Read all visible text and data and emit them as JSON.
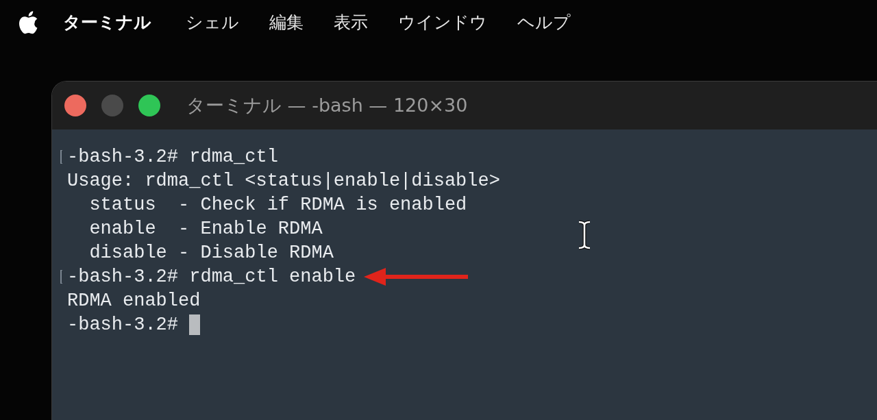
{
  "menu_bar": {
    "items": [
      {
        "label": "ターミナル",
        "kind": "app"
      },
      {
        "label": "シェル",
        "kind": "menu"
      },
      {
        "label": "編集",
        "kind": "menu"
      },
      {
        "label": "表示",
        "kind": "menu"
      },
      {
        "label": "ウインドウ",
        "kind": "menu"
      },
      {
        "label": "ヘルプ",
        "kind": "menu"
      }
    ]
  },
  "window": {
    "title": "ターミナル — -bash — 120×30",
    "lines": [
      {
        "text": "-bash-3.2# rdma_ctl",
        "marked": true,
        "arrow": false,
        "cursor": false
      },
      {
        "text": "Usage: rdma_ctl <status|enable|disable>",
        "marked": false,
        "arrow": false,
        "cursor": false
      },
      {
        "text": "  status  - Check if RDMA is enabled",
        "marked": false,
        "arrow": false,
        "cursor": false
      },
      {
        "text": "  enable  - Enable RDMA",
        "marked": false,
        "arrow": false,
        "cursor": false
      },
      {
        "text": "  disable - Disable RDMA",
        "marked": false,
        "arrow": false,
        "cursor": false
      },
      {
        "text": "-bash-3.2# rdma_ctl enable",
        "marked": true,
        "arrow": true,
        "cursor": false
      },
      {
        "text": "RDMA enabled",
        "marked": false,
        "arrow": false,
        "cursor": false
      },
      {
        "text": "-bash-3.2# ",
        "marked": false,
        "arrow": false,
        "cursor": true
      }
    ]
  }
}
